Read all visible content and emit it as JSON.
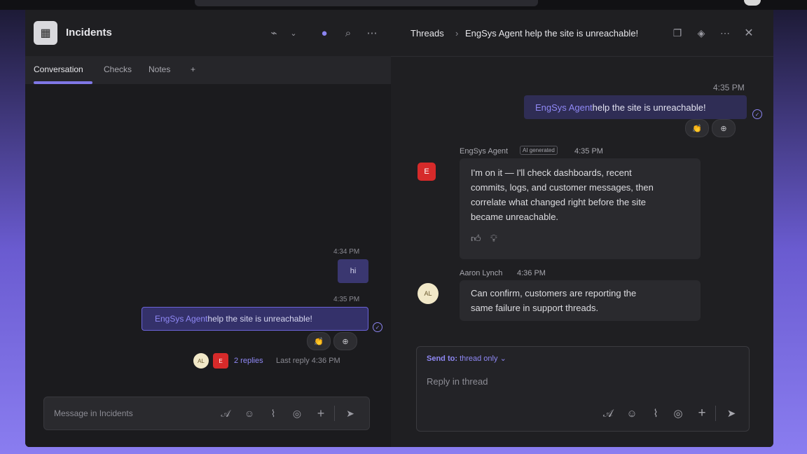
{
  "left": {
    "channel_title": "Incidents",
    "tabs": [
      {
        "label": "Conversation"
      },
      {
        "label": "Checks"
      },
      {
        "label": "Notes"
      },
      {
        "label": "+"
      }
    ],
    "messages": [
      {
        "time": "4:34 PM",
        "text": "hi"
      },
      {
        "time": "4:35 PM",
        "mention": "EngSys Agent",
        "text": " help the site is unreachable!"
      }
    ],
    "reactions": [
      "👏",
      "⊕"
    ],
    "replies": {
      "count_label": "2 replies",
      "last": "Last reply 4:36 PM"
    },
    "compose_placeholder": "Message in Incidents"
  },
  "right": {
    "breadcrumb": {
      "root": "Threads",
      "separator": "›",
      "current": "EngSys Agent help the site is unreachable!"
    },
    "own": {
      "time": "4:35 PM",
      "mention": "EngSys Agent",
      "text": " help the site is unreachable!"
    },
    "own_reactions": [
      "👏",
      "⊕"
    ],
    "agent": {
      "name": "EngSys Agent",
      "badge": "AI generated",
      "time": "4:35 PM",
      "avatar": "E",
      "lines": [
        "I'm on it — I'll check dashboards, recent",
        "commits, logs, and customer messages, then",
        "correlate what changed right before the site",
        "became unreachable."
      ],
      "feedback_icons": [
        "thumbs-up-icon",
        "lightbulb-icon"
      ]
    },
    "aaron": {
      "name": "Aaron Lynch",
      "time": "4:36 PM",
      "initials": "AL",
      "lines": [
        "Can confirm, customers are reporting the",
        "same failure in support threads."
      ]
    },
    "reply": {
      "send_to_label": "Send to:",
      "send_to_value": "thread only",
      "placeholder": "Reply in thread"
    }
  },
  "colors": {
    "accent": "#8b84f0",
    "bubble_own": "#34316a",
    "panel": "#1f1f22"
  }
}
